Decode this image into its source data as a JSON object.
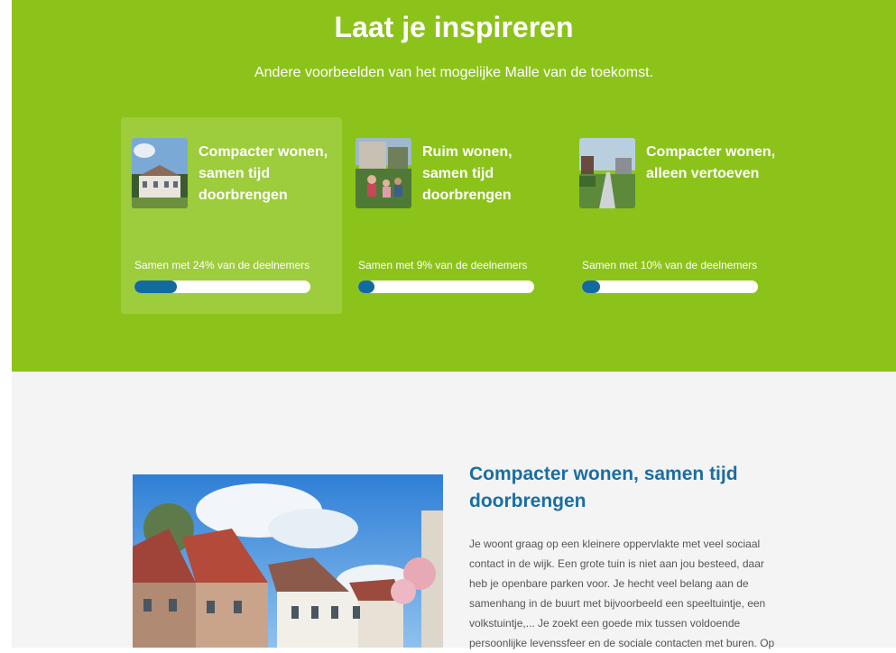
{
  "hero": {
    "title": "Laat je inspireren",
    "subtitle": "Andere voorbeelden van het mogelijke Malle van de toekomst.",
    "background_color": "#8cc31a"
  },
  "cards": [
    {
      "title": "Compacter wonen, samen tijd doorbrengen",
      "stat": "Samen met 24% van de deelnemers",
      "percent": 24,
      "active": true
    },
    {
      "title": "Ruim wonen, samen tijd doorbrengen",
      "stat": "Samen met 9% van de deelnemers",
      "percent": 9,
      "active": false
    },
    {
      "title": "Compacter wonen, alleen vertoeven",
      "stat": "Samen met 10% van de deelnemers",
      "percent": 10,
      "active": false
    }
  ],
  "detail": {
    "title": "Compacter wonen, samen tijd doorbrengen",
    "body": "Je woont graag op een kleinere oppervlakte met veel sociaal contact in de wijk. Een grote tuin is niet aan jou besteed, daar heb je openbare parken voor. Je hecht veel belang aan de samenhang in de buurt met bijvoorbeeld een speeltuintje, een volkstuintje,... Je zoekt een goede mix tussen voldoende persoonlijke levenssfeer en de sociale contacten met buren. Op"
  },
  "colors": {
    "accent_blue": "#136aa0",
    "title_blue": "#1a6ea3",
    "light_bg": "#f4f4f4"
  }
}
